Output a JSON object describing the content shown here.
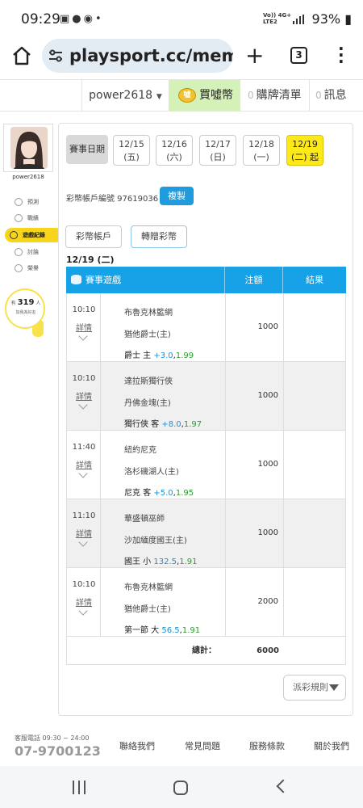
{
  "status_bar": {
    "time": "09:29",
    "notification_icons": [
      "image-icon",
      "chat-icon",
      "messenger-icon"
    ],
    "network_label_1": "Vo)) 4G+",
    "network_label_2": "LTE2",
    "battery": "93%"
  },
  "browser": {
    "url": "playsport.cc/meml",
    "tab_count": "3"
  },
  "header": {
    "username": "power2618",
    "coin_icon_label": "噓",
    "buy_coins": "買噓幣",
    "purchase_count": "0",
    "purchase_list": "購牌清單",
    "message_count": "0",
    "messages": "訊息"
  },
  "sidebar": {
    "username": "power2618",
    "items": [
      {
        "label": "預測",
        "icon": "predict-icon"
      },
      {
        "label": "戰績",
        "icon": "record-icon"
      },
      {
        "label": "遊戲紀錄",
        "icon": "game-log-icon",
        "active": true
      },
      {
        "label": "討論",
        "icon": "discussion-icon"
      },
      {
        "label": "榮譽",
        "icon": "honor-icon"
      }
    ],
    "bulb": {
      "prefix": "有",
      "count": "319",
      "suffix": "人",
      "caption": "加我為好友"
    }
  },
  "dates": {
    "label": "賽事日期",
    "tabs": [
      {
        "date": "12/15",
        "weekday": "(五)"
      },
      {
        "date": "12/16",
        "weekday": "(六)"
      },
      {
        "date": "12/17",
        "weekday": "(日)"
      },
      {
        "date": "12/18",
        "weekday": "(一)"
      },
      {
        "date": "12/19",
        "weekday": "(二) 起",
        "active": true
      }
    ]
  },
  "account": {
    "label": "彩幣帳戶編號 97619036",
    "copy_button": "複製"
  },
  "buttons": {
    "lottery_account": "彩幣帳戶",
    "transfer": "轉贈彩幣"
  },
  "section_date": "12/19 (二)",
  "table": {
    "headers": {
      "game": "賽事遊戲",
      "amount": "注額",
      "result": "結果"
    },
    "rows": [
      {
        "time": "10:10",
        "detail": "詳情",
        "away": "布魯克林籃網",
        "home": "猶他爵士(主)",
        "pick": "爵士 主",
        "line": "+3.0",
        "odds": "1.99",
        "amount": "1000",
        "result": ""
      },
      {
        "time": "10:10",
        "detail": "詳情",
        "away": "達拉斯獨行俠",
        "home": "丹佛金塊(主)",
        "pick": "獨行俠 客",
        "line": "+8.0",
        "odds": "1.97",
        "amount": "1000",
        "result": ""
      },
      {
        "time": "11:40",
        "detail": "詳情",
        "away": "紐約尼克",
        "home": "洛杉磯湖人(主)",
        "pick": "尼克 客",
        "line": "+5.0",
        "odds": "1.95",
        "amount": "1000",
        "result": ""
      },
      {
        "time": "11:10",
        "detail": "詳情",
        "away": "華盛頓巫師",
        "home": "沙加緬度國王(主)",
        "pick": "國王 小",
        "line": "132.5",
        "odds": "1.91",
        "amount": "1000",
        "result": ""
      },
      {
        "time": "10:10",
        "detail": "詳情",
        "away": "布魯克林籃網",
        "home": "猶他爵士(主)",
        "pick": "第一節 大",
        "line": "56.5",
        "odds": "1.91",
        "amount": "2000",
        "result": ""
      }
    ],
    "total_label": "總計：",
    "total_value": "6000"
  },
  "payout_rules": "派彩規則",
  "footer": {
    "hotline_label": "客服電話 09:30 ~ 24:00",
    "hotline_number": "07-9700123",
    "links": [
      "聯絡我們",
      "常見問題",
      "服務條款",
      "關於我們"
    ]
  },
  "colors": {
    "accent_blue": "#17a1e6",
    "active_yellow": "#fde91a",
    "buy_green": "#d4f2b7",
    "line_blue": "#1a8fd8",
    "odds_green": "#2a9d2a"
  }
}
